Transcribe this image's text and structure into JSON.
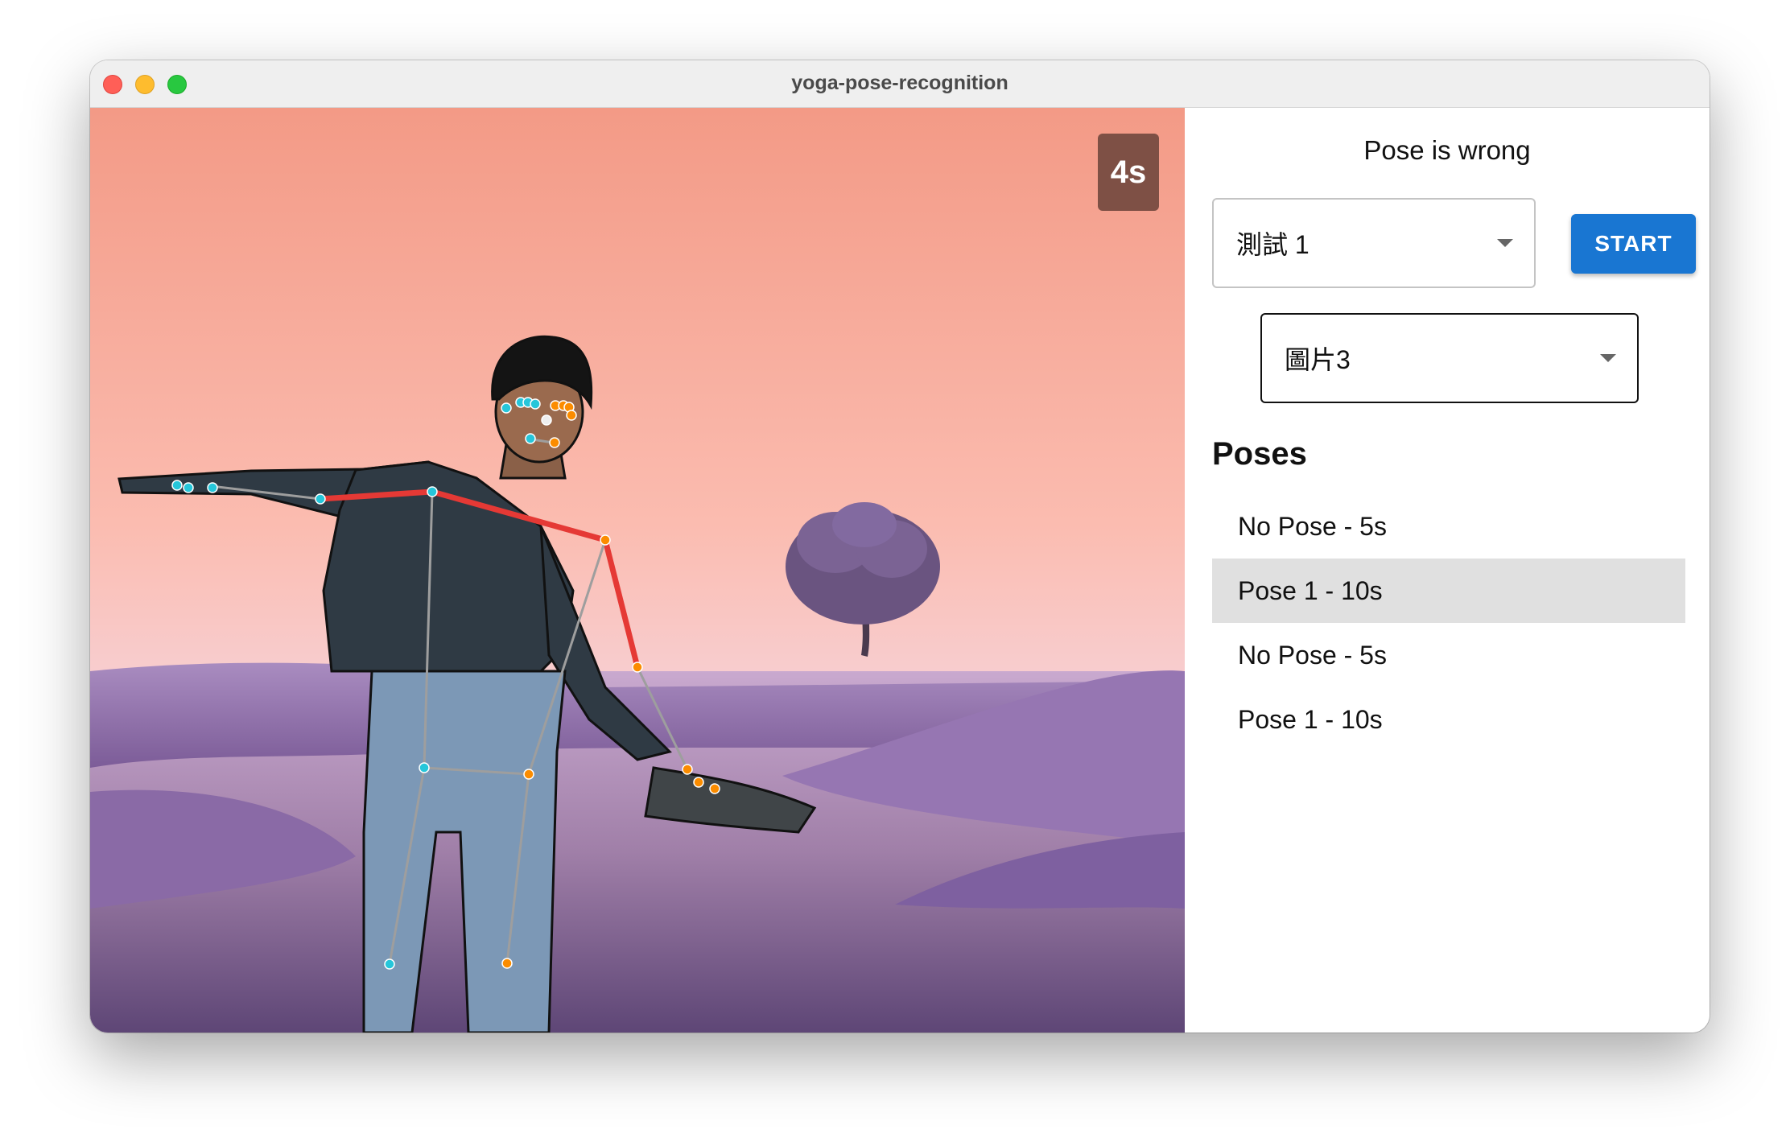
{
  "window": {
    "title": "yoga-pose-recognition"
  },
  "camera": {
    "countdown": "4s"
  },
  "panel": {
    "status": "Pose is wrong",
    "test_select": {
      "value": "測試 1"
    },
    "start_label": "START",
    "image_select": {
      "value": "圖片3"
    },
    "poses_heading": "Poses",
    "poses": [
      {
        "label": "No Pose - 5s",
        "active": false
      },
      {
        "label": "Pose 1 - 10s",
        "active": true
      },
      {
        "label": "No Pose - 5s",
        "active": false
      },
      {
        "label": "Pose 1 - 10s",
        "active": false
      }
    ]
  },
  "colors": {
    "start_button": "#1976d2",
    "timer_badge": "#7e5045",
    "active_row": "#e0e0e0",
    "skeleton_wrong": "#e53935",
    "keypoint_left": "#26c6da",
    "keypoint_right": "#fb8c00"
  }
}
